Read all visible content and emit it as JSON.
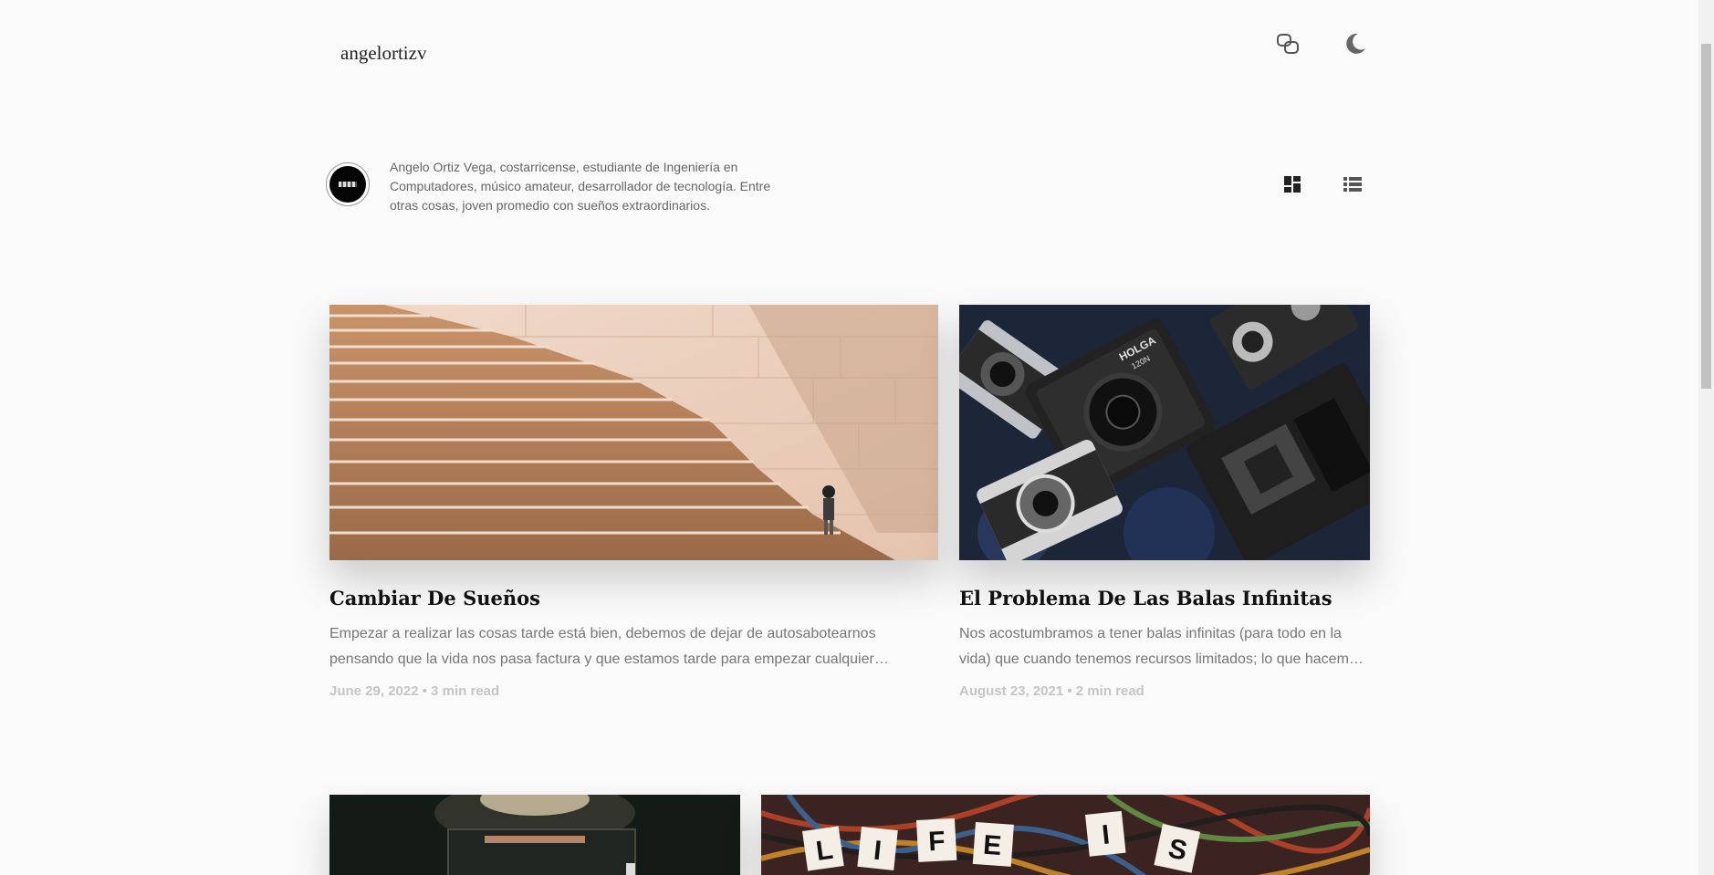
{
  "header": {
    "site_title": "angelortizv",
    "link_icon": "link-icon",
    "theme_icon": "moon-icon"
  },
  "author": {
    "bio": "Angelo Ortiz Vega, costarricense, estudiante de Ingeniería en Computadores, músico amateur, desarrollador de tecnología. Entre otras cosas, joven promedio con sueños extraordinarios.",
    "avatar_icon": "avatar"
  },
  "view_toggle": {
    "grid_icon": "grid-view-icon",
    "list_icon": "list-view-icon"
  },
  "posts": [
    {
      "title": "Cambiar De Sueños",
      "excerpt_line1": "Empezar a realizar las cosas tarde está bien, debemos de dejar de autosabotearnos",
      "excerpt_line2": "pensando que la vida nos pasa factura y que estamos tarde para empezar cualquier…",
      "meta": "June 29, 2022 • 3 min read"
    },
    {
      "title": "El Problema De Las Balas Infinitas",
      "excerpt_line1": "Nos acostumbramos a tener balas infinitas (para todo en la",
      "excerpt_line2": "vida) que cuando tenemos recursos limitados; lo que hacem…",
      "meta": "August 23, 2021 • 2 min read"
    }
  ],
  "image_text": {
    "camera_brand": "HOLGA",
    "camera_model": "120N",
    "scrabble_letters": [
      "L",
      "I",
      "F",
      "E",
      "I",
      "S"
    ]
  },
  "colors": {
    "background": "#fafafa",
    "title": "#111111",
    "excerpt": "#777777",
    "meta": "#c5c5c5"
  }
}
